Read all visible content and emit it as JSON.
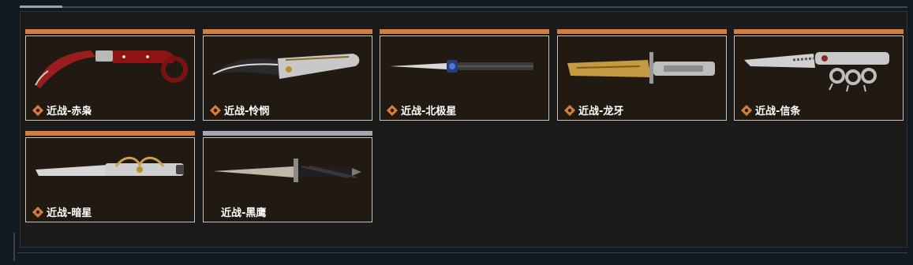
{
  "colors": {
    "background": "#131921",
    "panel": "#1b1b1c",
    "rarity_orange": "#d57b3b",
    "rarity_grey": "#a3a9ae",
    "card_border": "#c9c3b8"
  },
  "items": [
    {
      "name": "近战-赤枭",
      "rarity": "orange",
      "icon": "karambit-knife"
    },
    {
      "name": "近战-怜悯",
      "rarity": "orange",
      "icon": "curved-blade"
    },
    {
      "name": "近战-北极星",
      "rarity": "orange",
      "icon": "dagger"
    },
    {
      "name": "近战-龙牙",
      "rarity": "orange",
      "icon": "bayonet"
    },
    {
      "name": "近战-信条",
      "rarity": "orange",
      "icon": "knuckle-knife"
    },
    {
      "name": "近战-暗星",
      "rarity": "orange",
      "icon": "ornate-blade"
    },
    {
      "name": "近战-黑鹰",
      "rarity": "grey",
      "icon": "combat-knife"
    }
  ]
}
